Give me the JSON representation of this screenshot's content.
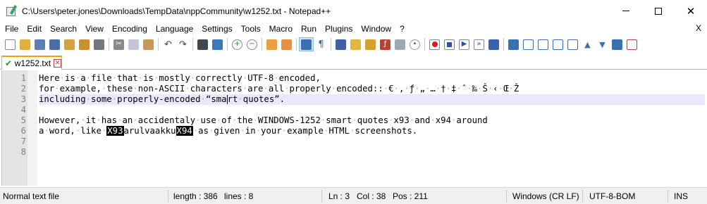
{
  "window": {
    "title": "C:\\Users\\peter.jones\\Downloads\\TempData\\nppCommunity\\w1252.txt - Notepad++",
    "minimize_glyph": "—",
    "maximize_glyph": "☐",
    "close_glyph": "✕"
  },
  "menu": {
    "items": [
      {
        "label": "File"
      },
      {
        "label": "Edit"
      },
      {
        "label": "Search"
      },
      {
        "label": "View"
      },
      {
        "label": "Encoding"
      },
      {
        "label": "Language"
      },
      {
        "label": "Settings"
      },
      {
        "label": "Tools"
      },
      {
        "label": "Macro"
      },
      {
        "label": "Run"
      },
      {
        "label": "Plugins"
      },
      {
        "label": "Window"
      },
      {
        "label": "?"
      }
    ],
    "close_label": "X"
  },
  "toolbar": {
    "icons": [
      "new-file-icon",
      "open-file-icon",
      "save-icon",
      "save-all-icon",
      "close-icon",
      "close-all-icon",
      "print-icon",
      "cut-icon",
      "copy-icon",
      "paste-icon",
      "undo-icon",
      "redo-icon",
      "find-icon",
      "replace-icon",
      "zoom-in-icon",
      "zoom-out-icon",
      "sync-vertical-icon",
      "sync-horizontal-icon",
      "word-wrap-icon",
      "show-all-chars-icon",
      "indent-guide-icon",
      "user-language-icon",
      "doc-map-icon",
      "function-list-icon",
      "folder-workspace-icon",
      "monitoring-icon",
      "record-macro-icon",
      "stop-record-icon",
      "play-macro-icon",
      "run-macro-multiple-icon",
      "save-macro-icon",
      "plugin-1-icon",
      "plugin-2-icon",
      "plugin-3-icon",
      "plugin-4-icon",
      "plugin-5-icon",
      "plugin-6-icon",
      "plugin-7-icon",
      "plugin-8-icon",
      "plugin-9-icon"
    ]
  },
  "tab": {
    "label": "w1252.txt",
    "close_glyph": "✕",
    "accent": "#f0a000"
  },
  "editor": {
    "line_numbers": [
      "1",
      "2",
      "3",
      "4",
      "5",
      "6",
      "7",
      "8"
    ],
    "lines": [
      "Here·is·a·file·that·is·mostly·correctly·UTF-8·encoded,",
      "for·example,·these·non-ASCII·characters·are·all·properly·encoded::·€·,·ƒ·„·…·†·‡·ˆ·‰·Š·‹·Œ·Ž",
      "including·some·properly-encoded·“sma",
      "rt·quotes”.",
      "",
      "However,·it·has·an·accidentaly·use·of·the·WINDOWS-1252·smart·quotes·x93·and·x94·around",
      "a·word,·like·",
      "X93",
      "arulvaakku",
      "X94",
      "·as·given·in·your·example·HTML·screenshots.",
      "",
      ""
    ],
    "current_line_color": "#e8e8ff"
  },
  "status": {
    "file_type": "Normal text file",
    "length": "length : 386",
    "lines": "lines : 8",
    "ln": "Ln : 3",
    "col": "Col : 38",
    "pos": "Pos : 211",
    "eol": "Windows (CR LF)",
    "encoding": "UTF-8-BOM",
    "mode": "INS"
  }
}
